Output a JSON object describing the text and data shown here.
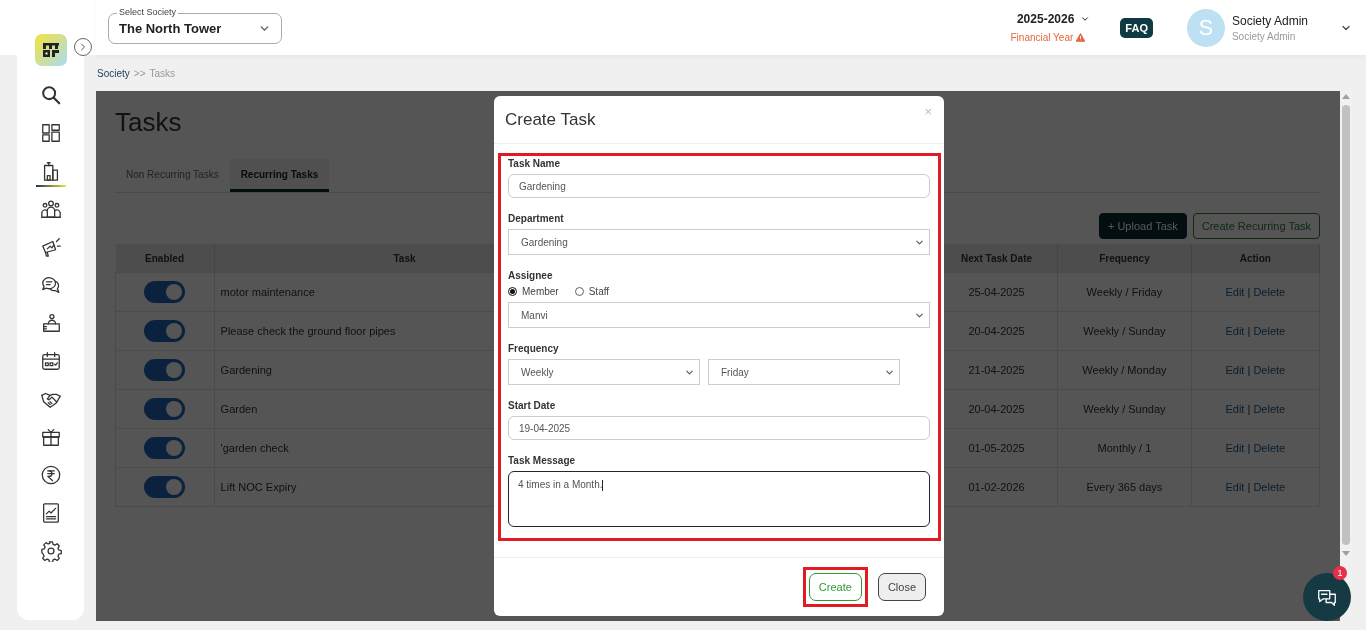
{
  "sidebar": {
    "items": [
      {
        "selected": false
      },
      {
        "selected": false
      },
      {
        "selected": true
      },
      {
        "selected": false
      },
      {
        "selected": false
      },
      {
        "selected": false
      },
      {
        "selected": false
      },
      {
        "selected": false
      },
      {
        "selected": false
      },
      {
        "selected": false
      },
      {
        "selected": false
      },
      {
        "selected": false
      },
      {
        "selected": false
      }
    ]
  },
  "topbar": {
    "society_select": {
      "label": "Select Society",
      "value": "The North Tower"
    },
    "financial_year": {
      "value": "2025-2026",
      "label": "Financial Year"
    },
    "faq": "FAQ",
    "user": {
      "initial": "S",
      "name": "Society Admin",
      "role": "Society Admin"
    }
  },
  "breadcrumb": {
    "items": [
      "Society",
      "Tasks"
    ],
    "separator": ">>"
  },
  "page": {
    "title": "Tasks",
    "tabs": [
      {
        "label": "Non Recurring Tasks",
        "selected": false
      },
      {
        "label": "Recurring Tasks",
        "selected": true
      }
    ],
    "buttons": [
      {
        "label": "+ Upload Task",
        "kind": "dark"
      },
      {
        "label": "Create Recurring Task",
        "kind": "outline"
      }
    ],
    "table": {
      "columns": [
        "Enabled",
        "Task",
        "Next Task Date",
        "Frequency",
        "Action"
      ],
      "rows": [
        {
          "enabled": true,
          "task": "motor maintenance",
          "next_date": "25-04-2025",
          "frequency": "Weekly / Friday",
          "actions": [
            "Edit",
            "Delete"
          ]
        },
        {
          "enabled": true,
          "task": "Please check the ground floor pipes",
          "next_date": "20-04-2025",
          "frequency": "Weekly / Sunday",
          "actions": [
            "Edit",
            "Delete"
          ]
        },
        {
          "enabled": true,
          "task": "Gardening",
          "next_date": "21-04-2025",
          "frequency": "Weekly / Monday",
          "actions": [
            "Edit",
            "Delete"
          ]
        },
        {
          "enabled": true,
          "task": "Garden",
          "next_date": "20-04-2025",
          "frequency": "Weekly / Sunday",
          "actions": [
            "Edit",
            "Delete"
          ]
        },
        {
          "enabled": true,
          "task": "'garden check",
          "next_date": "01-05-2025",
          "frequency": "Monthly / 1",
          "actions": [
            "Edit",
            "Delete"
          ]
        },
        {
          "enabled": true,
          "task": "Lift NOC Expiry",
          "next_date": "01-02-2026",
          "frequency": "Every 365 days",
          "actions": [
            "Edit",
            "Delete"
          ]
        }
      ],
      "action_separator": "|"
    }
  },
  "modal": {
    "title": "Create Task",
    "close": "×",
    "highlighted": true,
    "fields": [
      {
        "kind": "input",
        "label": "Task Name",
        "value": "Gardening"
      },
      {
        "kind": "select",
        "label": "Department",
        "value": "Gardening"
      },
      {
        "kind": "radio",
        "label": "Assignee",
        "options": [
          {
            "label": "Member",
            "selected": true
          },
          {
            "label": "Staff",
            "selected": false
          }
        ],
        "value": "Manvi"
      },
      {
        "kind": "select-pair",
        "label": "Frequency",
        "values": [
          "Weekly",
          "Friday"
        ]
      },
      {
        "kind": "input",
        "label": "Start Date",
        "value": "19-04-2025"
      },
      {
        "kind": "textarea",
        "label": "Task Message",
        "value": "4 times in a Month."
      }
    ],
    "buttons": [
      {
        "label": "Create",
        "kind": "primary",
        "highlighted": true
      },
      {
        "label": "Close",
        "kind": "secondary",
        "highlighted": false
      }
    ]
  },
  "chat": {
    "badge": "1"
  }
}
